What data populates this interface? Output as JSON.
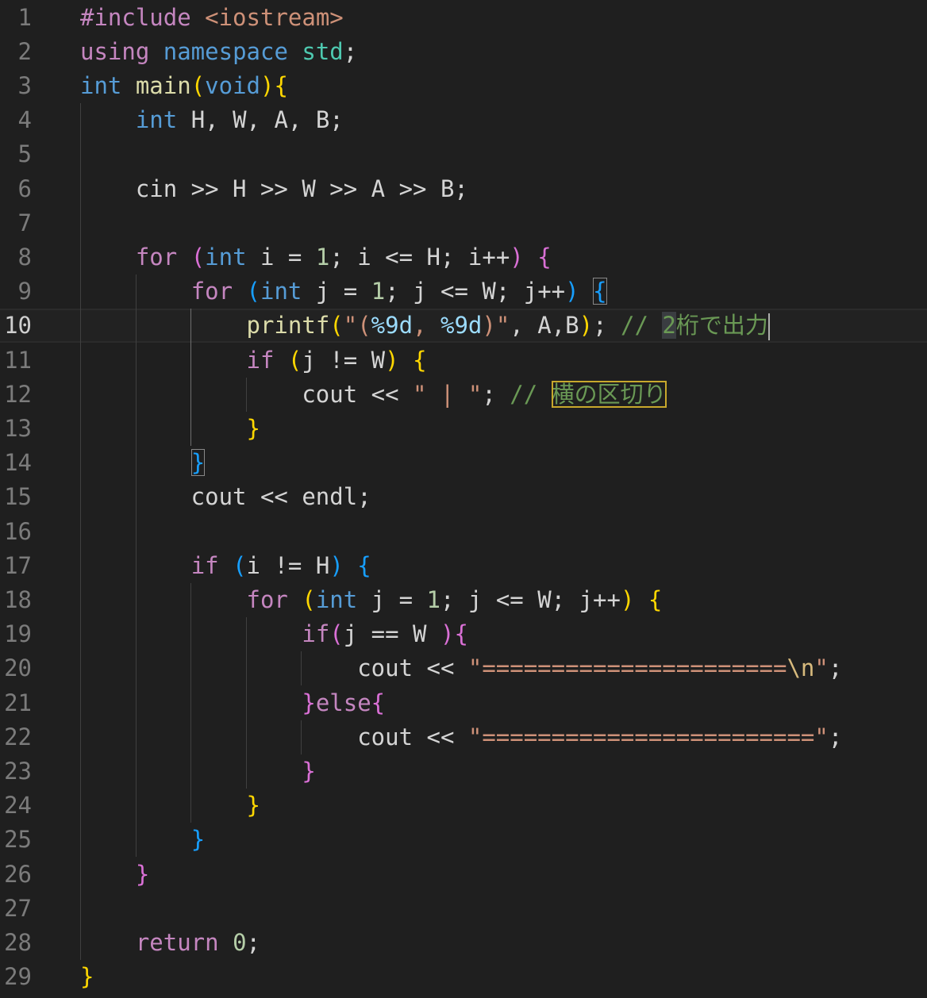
{
  "editor": {
    "line_numbers": [
      "1",
      "2",
      "3",
      "4",
      "5",
      "6",
      "7",
      "8",
      "9",
      "10",
      "11",
      "12",
      "13",
      "14",
      "15",
      "16",
      "17",
      "18",
      "19",
      "20",
      "21",
      "22",
      "23",
      "24",
      "25",
      "26",
      "27",
      "28",
      "29"
    ],
    "current_line": "10",
    "lines": [
      [
        [
          "pp",
          "#include "
        ],
        [
          "inc",
          "<iostream>"
        ]
      ],
      [
        [
          "ctrl",
          "using "
        ],
        [
          "kw",
          "namespace "
        ],
        [
          "ty",
          "std"
        ],
        [
          "id",
          ";"
        ]
      ],
      [
        [
          "kw",
          "int "
        ],
        [
          "fn",
          "main"
        ],
        [
          "b1",
          "("
        ],
        [
          "kw",
          "void"
        ],
        [
          "b1",
          ")"
        ],
        [
          "b1",
          "{"
        ]
      ],
      [
        [
          "id",
          "    "
        ],
        [
          "kw",
          "int "
        ],
        [
          "id",
          "H, W, A, B;"
        ]
      ],
      [],
      [
        [
          "id",
          "    cin >> H >> W >> A >> B;"
        ]
      ],
      [],
      [
        [
          "id",
          "    "
        ],
        [
          "ctrl",
          "for "
        ],
        [
          "b2",
          "("
        ],
        [
          "kw",
          "int "
        ],
        [
          "id",
          "i = "
        ],
        [
          "num",
          "1"
        ],
        [
          "id",
          "; i <= H; i++"
        ],
        [
          "b2",
          ")"
        ],
        [
          "id",
          " "
        ],
        [
          "b2",
          "{"
        ]
      ],
      [
        [
          "id",
          "        "
        ],
        [
          "ctrl",
          "for "
        ],
        [
          "b3",
          "("
        ],
        [
          "kw",
          "int "
        ],
        [
          "id",
          "j = "
        ],
        [
          "num",
          "1"
        ],
        [
          "id",
          "; j <= W; j++"
        ],
        [
          "b3",
          ")"
        ],
        [
          "id",
          " "
        ],
        [
          "b3m",
          "{"
        ]
      ],
      [
        [
          "id",
          "            "
        ],
        [
          "fn",
          "printf"
        ],
        [
          "b1",
          "("
        ],
        [
          "str",
          "\"("
        ],
        [
          "fmt",
          "%9d"
        ],
        [
          "str",
          ", "
        ],
        [
          "fmt",
          "%9d"
        ],
        [
          "str",
          ")\""
        ],
        [
          "id",
          ", A,B"
        ],
        [
          "b1",
          ")"
        ],
        [
          "id",
          "; "
        ],
        [
          "com",
          "// "
        ],
        [
          "comsel",
          "2"
        ],
        [
          "com",
          "桁で出力"
        ],
        [
          "cursor",
          ""
        ]
      ],
      [
        [
          "id",
          "            "
        ],
        [
          "ctrl",
          "if "
        ],
        [
          "b1",
          "("
        ],
        [
          "id",
          "j != W"
        ],
        [
          "b1",
          ")"
        ],
        [
          "id",
          " "
        ],
        [
          "b1",
          "{"
        ]
      ],
      [
        [
          "id",
          "                cout << "
        ],
        [
          "str",
          "\" | \""
        ],
        [
          "id",
          "; "
        ],
        [
          "com",
          "// "
        ],
        [
          "combox",
          "横の区切り"
        ]
      ],
      [
        [
          "id",
          "            "
        ],
        [
          "b1",
          "}"
        ]
      ],
      [
        [
          "id",
          "        "
        ],
        [
          "b3m",
          "}"
        ]
      ],
      [
        [
          "id",
          "        cout << endl;"
        ]
      ],
      [],
      [
        [
          "id",
          "        "
        ],
        [
          "ctrl",
          "if "
        ],
        [
          "b3",
          "("
        ],
        [
          "id",
          "i != H"
        ],
        [
          "b3",
          ")"
        ],
        [
          "id",
          " "
        ],
        [
          "b3",
          "{"
        ]
      ],
      [
        [
          "id",
          "            "
        ],
        [
          "ctrl",
          "for "
        ],
        [
          "b1",
          "("
        ],
        [
          "kw",
          "int "
        ],
        [
          "id",
          "j = "
        ],
        [
          "num",
          "1"
        ],
        [
          "id",
          "; j <= W; j++"
        ],
        [
          "b1",
          ")"
        ],
        [
          "id",
          " "
        ],
        [
          "b1",
          "{"
        ]
      ],
      [
        [
          "id",
          "                "
        ],
        [
          "ctrl",
          "if"
        ],
        [
          "b2",
          "("
        ],
        [
          "id",
          "j == W "
        ],
        [
          "b2",
          ")"
        ],
        [
          "b2",
          "{"
        ]
      ],
      [
        [
          "id",
          "                    cout << "
        ],
        [
          "str",
          "\"======================"
        ],
        [
          "esc",
          "\\n"
        ],
        [
          "str",
          "\""
        ],
        [
          "id",
          ";"
        ]
      ],
      [
        [
          "id",
          "                "
        ],
        [
          "b2",
          "}"
        ],
        [
          "ctrl",
          "else"
        ],
        [
          "b2",
          "{"
        ]
      ],
      [
        [
          "id",
          "                    cout << "
        ],
        [
          "str",
          "\"========================\""
        ],
        [
          "id",
          ";"
        ]
      ],
      [
        [
          "id",
          "                "
        ],
        [
          "b2",
          "}"
        ]
      ],
      [
        [
          "id",
          "            "
        ],
        [
          "b1",
          "}"
        ]
      ],
      [
        [
          "id",
          "        "
        ],
        [
          "b3",
          "}"
        ]
      ],
      [
        [
          "id",
          "    "
        ],
        [
          "b2",
          "}"
        ]
      ],
      [],
      [
        [
          "id",
          "    "
        ],
        [
          "ctrl",
          "return "
        ],
        [
          "num",
          "0"
        ],
        [
          "id",
          ";"
        ]
      ],
      [
        [
          "b1",
          "}"
        ]
      ]
    ],
    "colors": {
      "background": "#1f1f1f",
      "keyword": "#569cd6",
      "control": "#c586c0",
      "function": "#dcdcaa",
      "string": "#ce9178",
      "comment": "#6a9955",
      "number": "#b5cea8",
      "highlight_box": "#c8a82c"
    }
  }
}
